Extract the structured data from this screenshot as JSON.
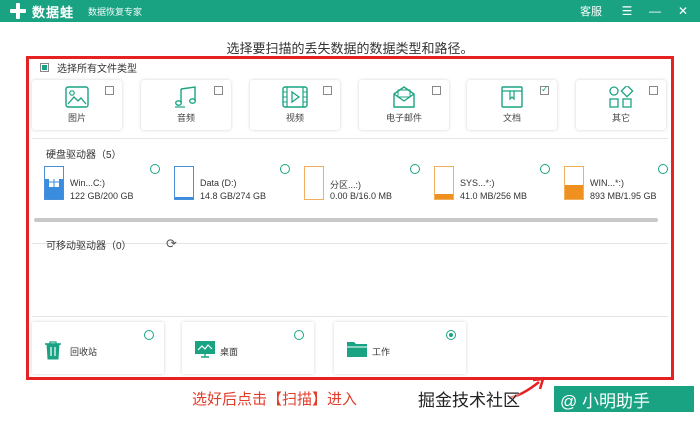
{
  "titlebar": {
    "app_name": "数据蛙",
    "tagline": "数据恢复专家",
    "support_label": "客服",
    "menu_glyph": "☰",
    "minimize_glyph": "—",
    "close_glyph": "✕"
  },
  "headline": "选择要扫描的丢失数据的数据类型和路径。",
  "select_all_label": "选择所有文件类型",
  "file_types": [
    {
      "label": "图片",
      "icon": "image-icon",
      "checked": false
    },
    {
      "label": "音频",
      "icon": "music-icon",
      "checked": false
    },
    {
      "label": "视频",
      "icon": "video-icon",
      "checked": false
    },
    {
      "label": "电子邮件",
      "icon": "email-icon",
      "checked": false
    },
    {
      "label": "文档",
      "icon": "document-icon",
      "checked": true
    },
    {
      "label": "其它",
      "icon": "other-icon",
      "checked": false
    }
  ],
  "drives_section": {
    "label": "硬盘驱动器（5）"
  },
  "drives": [
    {
      "name": "Win...C:)",
      "size": "122 GB/200 GB",
      "used_fraction": 0.61,
      "color": "#3a8dde",
      "windows_logo": true
    },
    {
      "name": "Data (D:)",
      "size": "14.8 GB/274 GB",
      "used_fraction": 0.05,
      "color": "#3a8dde",
      "windows_logo": false
    },
    {
      "name": "分区...:)",
      "size": "0.00  B/16.0 MB",
      "used_fraction": 0.0,
      "color": "#f0901e",
      "windows_logo": false
    },
    {
      "name": "SYS...*:)",
      "size": "41.0 MB/256 MB",
      "used_fraction": 0.16,
      "color": "#f0901e",
      "windows_logo": false
    },
    {
      "name": "WIN...*:)",
      "size": "893 MB/1.95 GB",
      "used_fraction": 0.45,
      "color": "#f0901e",
      "windows_logo": false
    }
  ],
  "removable_section": {
    "label": "可移动驱动器（0）",
    "refresh_glyph": "⟳"
  },
  "locations": [
    {
      "label": "回收站",
      "icon": "recycle-bin-icon",
      "selected": false
    },
    {
      "label": "桌面",
      "icon": "desktop-icon",
      "selected": false
    },
    {
      "label": "工作",
      "icon": "folder-icon",
      "selected": true
    }
  ],
  "annotation": {
    "instruction": "选好后点击【扫描】进入"
  },
  "watermark": {
    "text": "掘金技术社区",
    "badge": "@ 小明助手"
  },
  "colors": {
    "brand": "#1aa383",
    "annotation_red": "#e62121",
    "drive_blue": "#3a8dde",
    "drive_orange": "#f0901e"
  }
}
